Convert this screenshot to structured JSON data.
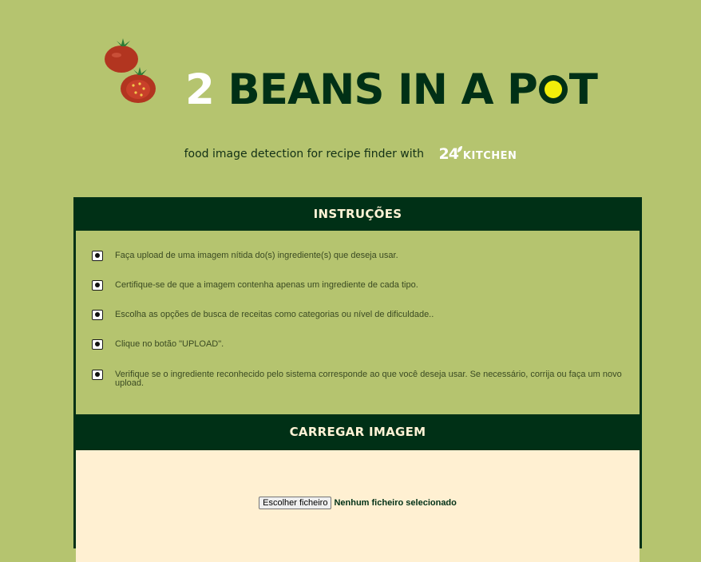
{
  "header": {
    "logo_number": "2",
    "logo_words": "BEANS IN A P",
    "logo_end": "T",
    "subtitle": "food image detection for recipe finder with",
    "partner_number": "24",
    "partner_name": "KITCHEN"
  },
  "instructions": {
    "title": "INSTRUÇÕES",
    "items": [
      "Faça upload de uma imagem nítida do(s) ingrediente(s) que deseja usar.",
      "Certifique-se de que a imagem contenha apenas um ingrediente de cada tipo.",
      "Escolha as opções de busca de receitas como categorias ou nível de dificuldade..",
      "Clique no botão \"UPLOAD\".",
      "Verifique se o ingrediente reconhecido pelo sistema corresponde ao que você deseja usar. Se necessário, corrija ou faça um novo upload."
    ]
  },
  "upload": {
    "title": "CARREGAR IMAGEM",
    "choose_button": "Escolher ficheiro",
    "status": "Nenhum ficheiro selecionado"
  },
  "colors": {
    "background": "#b5c46f",
    "dark_green": "#003016",
    "cream": "#fff0d2",
    "accent_yellow": "#f2ee0a"
  }
}
